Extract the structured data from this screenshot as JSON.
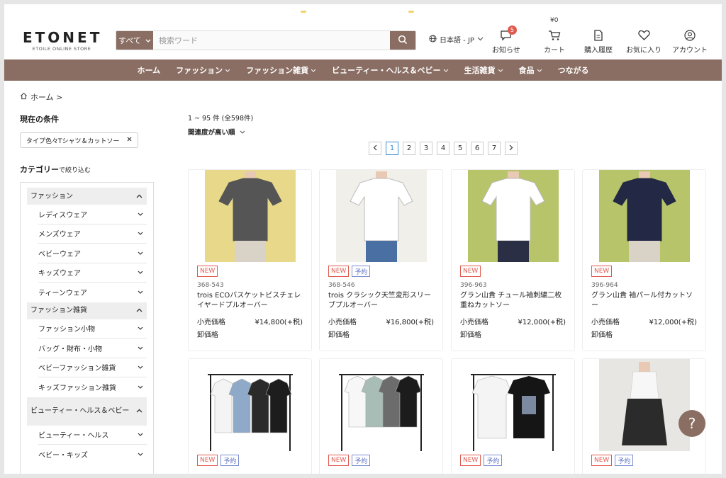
{
  "header": {
    "logo": "ETONET",
    "logo_sub": "ETOILE ONLINE STORE",
    "search_scope": "すべて",
    "search_placeholder": "検索ワード",
    "language": "日本語 - JP",
    "notice_label": "お知らせ",
    "notice_badge": "5",
    "cart_amount": "¥0",
    "cart_label": "カート",
    "history_label": "購入履歴",
    "favorite_label": "お気に入り",
    "account_label": "アカウント"
  },
  "nav": [
    {
      "label": "ホーム",
      "dropdown": false
    },
    {
      "label": "ファッション",
      "dropdown": true
    },
    {
      "label": "ファッション雑貨",
      "dropdown": true
    },
    {
      "label": "ビューティー・ヘルス＆ベビー",
      "dropdown": true
    },
    {
      "label": "生活雑貨",
      "dropdown": true
    },
    {
      "label": "食品",
      "dropdown": true
    },
    {
      "label": "つながる",
      "dropdown": false
    }
  ],
  "breadcrumb": "ホーム >",
  "sidebar": {
    "conditions_title": "現在の条件",
    "condition_chip": "タイプ色々Tシャツ＆カットソー",
    "category_title": "カテゴリー",
    "category_title_sub": "で絞り込む",
    "groups": [
      {
        "label": "ファッション",
        "items": [
          "レディスウェア",
          "メンズウェア",
          "ベビーウェア",
          "キッズウェア",
          "ティーンウェア"
        ]
      },
      {
        "label": "ファッション雑貨",
        "items": [
          "ファッション小物",
          "バッグ・財布・小物",
          "ベビーファッション雑貨",
          "キッズファッション雑貨"
        ]
      },
      {
        "label": "ビューティー・ヘルス＆ベビー",
        "items": [
          "ビューティー・ヘルス",
          "ベビー・キッズ"
        ]
      }
    ]
  },
  "results": {
    "count": "1 ~ 95 件 (全598件)",
    "sort": "関連度が高い順",
    "pages": [
      "1",
      "2",
      "3",
      "4",
      "5",
      "6",
      "7"
    ],
    "current_page": "1"
  },
  "products": [
    {
      "tags": [
        "NEW"
      ],
      "code": "368-543",
      "name": "trois ECOバスケットビスチェレイヤードプルオーバー",
      "price_label": "小売価格",
      "price": "¥14,800(+税)",
      "wholesale_label": "卸価格",
      "photo_color": "#e8d98a",
      "shirt_color": "#555555"
    },
    {
      "tags": [
        "NEW",
        "予約"
      ],
      "code": "368-546",
      "name": "trois クラシック天竺変形スリーブプルオーバー",
      "price_label": "小売価格",
      "price": "¥16,800(+税)",
      "wholesale_label": "卸価格",
      "photo_color": "#f1efe9",
      "shirt_color": "#ffffff"
    },
    {
      "tags": [
        "NEW"
      ],
      "code": "396-963",
      "name": "グラン山貴 チュール袖刺繍二枚重ねカットソー",
      "price_label": "小売価格",
      "price": "¥12,000(+税)",
      "wholesale_label": "卸価格",
      "photo_color": "#b7c46a",
      "shirt_color": "#ffffff"
    },
    {
      "tags": [
        "NEW"
      ],
      "code": "396-964",
      "name": "グラン山貴 袖パール付カットソー",
      "price_label": "小売価格",
      "price": "¥12,000(+税)",
      "wholesale_label": "卸価格",
      "photo_color": "#b7c46a",
      "shirt_color": "#232845"
    },
    {
      "tags": [
        "NEW",
        "予約"
      ],
      "code": "",
      "name": "",
      "price_label": "",
      "price": "",
      "wholesale_label": "",
      "photo_color": "#ffffff",
      "shirt_color": "#222222"
    },
    {
      "tags": [
        "NEW",
        "予約"
      ],
      "code": "",
      "name": "",
      "price_label": "",
      "price": "",
      "wholesale_label": "",
      "photo_color": "#ffffff",
      "shirt_color": "#ffffff"
    },
    {
      "tags": [
        "NEW",
        "予約"
      ],
      "code": "",
      "name": "",
      "price_label": "",
      "price": "",
      "wholesale_label": "",
      "photo_color": "#ffffff",
      "shirt_color": "#111111"
    },
    {
      "tags": [
        "NEW",
        "予約"
      ],
      "code": "",
      "name": "",
      "price_label": "",
      "price": "",
      "wholesale_label": "",
      "photo_color": "#e8e6e2",
      "shirt_color": "#ffffff"
    }
  ],
  "help_label": "?"
}
